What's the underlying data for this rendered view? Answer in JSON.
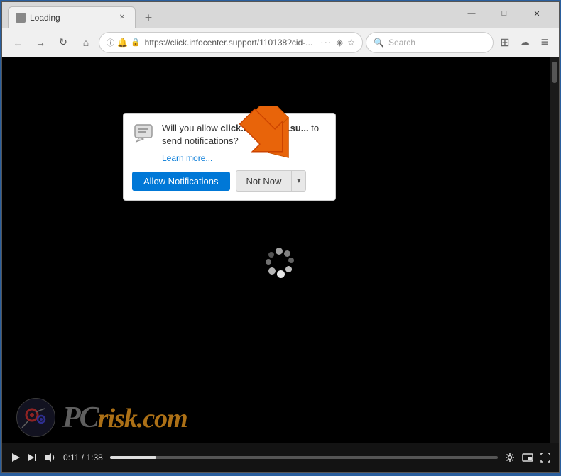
{
  "browser": {
    "tab": {
      "title": "Loading",
      "favicon": "page-icon"
    },
    "new_tab_label": "+",
    "window_controls": {
      "minimize": "—",
      "maximize": "□",
      "close": "✕"
    },
    "nav": {
      "back": "←",
      "forward": "→",
      "refresh": "↻",
      "home": "⌂",
      "info_icon": "ⓘ",
      "lock_icon": "🔒",
      "url": "https://click.infocenter.support/110138?cid-...",
      "more": "···",
      "pocket": "◈",
      "star": "☆"
    },
    "search": {
      "placeholder": "Search",
      "icon": "🔍"
    },
    "toolbar_icons": {
      "library": "|||",
      "sync": "☁",
      "menu": "≡"
    }
  },
  "notification": {
    "question": "Will you allow ",
    "site_bold": "click.infocenter.su...",
    "question_end": " to send notifications?",
    "learn_more": "Learn more...",
    "allow_btn": "Allow Notifications",
    "not_now_btn": "Not Now"
  },
  "video": {
    "time_current": "0:11",
    "time_total": "1:38",
    "progress_percent": 12
  },
  "pcrisk": {
    "domain": "risk.com",
    "pc_part": "P",
    "c_part": "C"
  }
}
